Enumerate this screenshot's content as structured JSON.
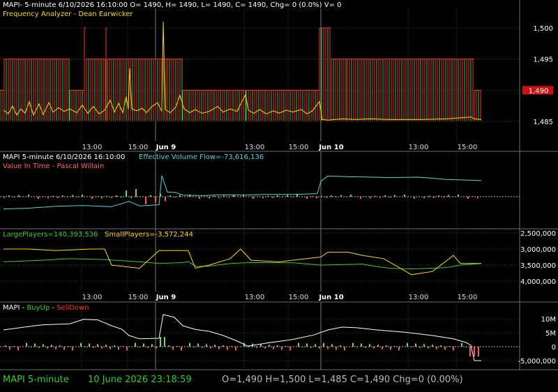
{
  "colors": {
    "background": "#000000",
    "grid": "#3a3a3a",
    "divider": "#6e6e6e",
    "label_white": "#ffffff",
    "yellow": "#ffd800",
    "red": "#ff3030",
    "green": "#33cc33",
    "cyan": "#4fd8d8",
    "up_bar": "#66dd66",
    "down_bar": "#ff5555",
    "status_green": "#29d12b",
    "status_gray": "#bbbbbb"
  },
  "panel1": {
    "header": "MAPI- 5-minute 6/10/2026 16:10:00 O= 1490, H= 1490, L= 1490, C= 1490, Chg= 0 (0.0%) V= 0",
    "study": "Frequency Analyzer - Dean Earwicker",
    "price_label": "1,490"
  },
  "panel2": {
    "header": "MAPI 5-minute  6/10/2026 16:10:00",
    "evf_label": "Effective Volume Flow=-73,616,136",
    "study": "Value In Time - Pascal Willain"
  },
  "panel3": {
    "large_label": "LargePlayers=140,393,536",
    "small_label": "SmallPlayers=-3,572,244"
  },
  "panel4": {
    "name": "MAPI",
    "sep1": " - ",
    "buyup": "BuyUp",
    "sep2": " - ",
    "selldown": "SellDown"
  },
  "status": {
    "symbol": "MAPI  5-minute",
    "datetime": "10 June 2026 23:18:59",
    "ohlc": "O=1,490  H=1,500  L=1,485  C=1,490  Chg=0 (0.00%)"
  },
  "chart_data": [
    {
      "type": "line",
      "title": "Frequency Analyzer - Dean Earwicker",
      "price_ticks": [
        "1,500",
        "1,495",
        "1,490",
        "1,485"
      ],
      "ylim": [
        1484,
        1502
      ],
      "x_tick_labels": [
        "13:00",
        "15:00",
        "Jun 9",
        "13:00",
        "15:00",
        "Jun 10",
        "13:00",
        "15:00"
      ],
      "price_steps": [
        {
          "x0": 0,
          "x1": 6,
          "value": 1490
        },
        {
          "x0": 6,
          "x1": 100,
          "value": 1495
        },
        {
          "x0": 100,
          "x1": 121,
          "value": 1490
        },
        {
          "x0": 121,
          "x1": 124,
          "value": 1500
        },
        {
          "x0": 124,
          "x1": 152,
          "value": 1495
        },
        {
          "x0": 152,
          "x1": 154,
          "value": 1500
        },
        {
          "x0": 154,
          "x1": 240,
          "value": 1495
        },
        {
          "x0": 240,
          "x1": 262,
          "value": 1495
        },
        {
          "x0": 262,
          "x1": 353,
          "value": 1490
        },
        {
          "x0": 353,
          "x1": 458,
          "value": 1490
        },
        {
          "x0": 458,
          "x1": 475,
          "value": 1500
        },
        {
          "x0": 475,
          "x1": 498,
          "value": 1495
        },
        {
          "x0": 498,
          "x1": 680,
          "value": 1495
        },
        {
          "x0": 680,
          "x1": 690,
          "value": 1490
        }
      ],
      "oscillator": [
        [
          5,
          1486.8
        ],
        [
          12,
          1486.2
        ],
        [
          18,
          1487.5
        ],
        [
          24,
          1486.0
        ],
        [
          30,
          1487.0
        ],
        [
          36,
          1486.3
        ],
        [
          42,
          1488.2
        ],
        [
          48,
          1486.0
        ],
        [
          56,
          1487.8
        ],
        [
          62,
          1486.1
        ],
        [
          70,
          1488.0
        ],
        [
          76,
          1486.5
        ],
        [
          84,
          1487.2
        ],
        [
          92,
          1486.6
        ],
        [
          100,
          1487.0
        ],
        [
          110,
          1486.4
        ],
        [
          118,
          1487.6
        ],
        [
          126,
          1486.3
        ],
        [
          134,
          1487.4
        ],
        [
          142,
          1486.2
        ],
        [
          150,
          1486.8
        ],
        [
          158,
          1488.4
        ],
        [
          164,
          1486.5
        ],
        [
          170,
          1487.9
        ],
        [
          176,
          1486.4
        ],
        [
          181,
          1489.0
        ],
        [
          184,
          1486.9
        ],
        [
          186,
          1493.5
        ],
        [
          189,
          1487.0
        ],
        [
          196,
          1486.7
        ],
        [
          204,
          1487.1
        ],
        [
          210,
          1486.4
        ],
        [
          218,
          1487.4
        ],
        [
          226,
          1488.0
        ],
        [
          232,
          1486.6
        ],
        [
          234,
          1501.0
        ],
        [
          237,
          1486.9
        ],
        [
          244,
          1486.4
        ],
        [
          252,
          1487.3
        ],
        [
          258,
          1489.2
        ],
        [
          264,
          1487.0
        ],
        [
          272,
          1486.4
        ],
        [
          280,
          1486.9
        ],
        [
          290,
          1486.3
        ],
        [
          300,
          1486.6
        ],
        [
          312,
          1487.4
        ],
        [
          320,
          1486.5
        ],
        [
          330,
          1487.0
        ],
        [
          340,
          1486.6
        ],
        [
          346,
          1488.0
        ],
        [
          352,
          1489.3
        ],
        [
          356,
          1486.8
        ],
        [
          364,
          1486.3
        ],
        [
          372,
          1486.9
        ],
        [
          382,
          1486.2
        ],
        [
          392,
          1486.7
        ],
        [
          400,
          1486.3
        ],
        [
          410,
          1486.8
        ],
        [
          420,
          1486.5
        ],
        [
          432,
          1486.9
        ],
        [
          440,
          1486.2
        ],
        [
          448,
          1486.7
        ],
        [
          458,
          1488.2
        ],
        [
          462,
          1485.3
        ],
        [
          470,
          1485.2
        ],
        [
          490,
          1485.4
        ],
        [
          510,
          1485.3
        ],
        [
          530,
          1485.4
        ],
        [
          560,
          1485.3
        ],
        [
          600,
          1485.3
        ],
        [
          640,
          1485.4
        ],
        [
          675,
          1485.7
        ],
        [
          680,
          1485.4
        ],
        [
          690,
          1485.3
        ]
      ]
    },
    {
      "type": "line",
      "title": "Effective Volume Flow",
      "series": [
        {
          "name": "Effective Volume Flow",
          "values": [
            [
              5,
              -3.2
            ],
            [
              40,
              -3.0
            ],
            [
              80,
              -2.5
            ],
            [
              120,
              -2.3
            ],
            [
              160,
              -2.6
            ],
            [
              185,
              -1.2
            ],
            [
              200,
              -2.4
            ],
            [
              228,
              -2.1
            ],
            [
              232,
              5.5
            ],
            [
              240,
              1.2
            ],
            [
              252,
              1.1
            ],
            [
              262,
              0.4
            ],
            [
              290,
              0.3
            ],
            [
              320,
              0.5
            ],
            [
              350,
              0.4
            ],
            [
              380,
              0.6
            ],
            [
              420,
              0.6
            ],
            [
              455,
              0.8
            ],
            [
              460,
              4.0
            ],
            [
              470,
              5.4
            ],
            [
              500,
              5.2
            ],
            [
              560,
              5.0
            ],
            [
              600,
              5.1
            ],
            [
              640,
              4.5
            ],
            [
              690,
              4.2
            ]
          ]
        }
      ],
      "ylim": [
        -8,
        9
      ]
    },
    {
      "type": "line",
      "title": "LargePlayers / SmallPlayers",
      "y_ticks": [
        "2,500,000",
        "3,000,000",
        "3,500,000",
        "4,000,000"
      ],
      "ylim": [
        2300000,
        4100000
      ],
      "x_tick_labels": [
        "13:00",
        "15:00",
        "Jun 9",
        "13:00",
        "15:00",
        "Jun 10",
        "13:00",
        "15:00"
      ],
      "series": [
        {
          "name": "LargePlayers",
          "values": [
            [
              5,
              3400000
            ],
            [
              60,
              3350000
            ],
            [
              100,
              3300000
            ],
            [
              150,
              3330000
            ],
            [
              200,
              3400000
            ],
            [
              230,
              3450000
            ],
            [
              262,
              3420000
            ],
            [
              270,
              3400000
            ],
            [
              282,
              3550000
            ],
            [
              300,
              3530000
            ],
            [
              330,
              3450000
            ],
            [
              360,
              3420000
            ],
            [
              420,
              3430000
            ],
            [
              460,
              3500000
            ],
            [
              500,
              3480000
            ],
            [
              520,
              3470000
            ],
            [
              540,
              3550000
            ],
            [
              560,
              3600000
            ],
            [
              590,
              3620000
            ],
            [
              640,
              3580000
            ],
            [
              660,
              3500000
            ],
            [
              690,
              3450000
            ]
          ]
        },
        {
          "name": "SmallPlayers",
          "values": [
            [
              5,
              3000000
            ],
            [
              40,
              3000000
            ],
            [
              80,
              3050000
            ],
            [
              130,
              3000000
            ],
            [
              150,
              3000000
            ],
            [
              160,
              3500000
            ],
            [
              200,
              3600000
            ],
            [
              228,
              3050000
            ],
            [
              270,
              3050000
            ],
            [
              280,
              3600000
            ],
            [
              300,
              3500000
            ],
            [
              330,
              3300000
            ],
            [
              345,
              3000000
            ],
            [
              360,
              3350000
            ],
            [
              400,
              3400000
            ],
            [
              440,
              3300000
            ],
            [
              460,
              3250000
            ],
            [
              470,
              3100000
            ],
            [
              500,
              3100000
            ],
            [
              520,
              3200000
            ],
            [
              550,
              3300000
            ],
            [
              590,
              3800000
            ],
            [
              620,
              3700000
            ],
            [
              650,
              3200000
            ],
            [
              660,
              3450000
            ],
            [
              690,
              3450000
            ]
          ]
        }
      ]
    },
    {
      "type": "bar",
      "title": "BuyUp - SellDown",
      "y_ticks": [
        "10M",
        "5M",
        "0",
        "-5,000,000"
      ],
      "ylim": [
        -6000000,
        12000000
      ],
      "series": [
        {
          "name": "cumulative",
          "values": [
            [
              5,
              6000000
            ],
            [
              20,
              6500000
            ],
            [
              40,
              7200000
            ],
            [
              60,
              7800000
            ],
            [
              80,
              8000000
            ],
            [
              100,
              8200000
            ],
            [
              120,
              9800000
            ],
            [
              140,
              9600000
            ],
            [
              160,
              7500000
            ],
            [
              175,
              6200000
            ],
            [
              185,
              4000000
            ],
            [
              200,
              2800000
            ],
            [
              228,
              3000000
            ],
            [
              234,
              11500000
            ],
            [
              250,
              10500000
            ],
            [
              262,
              7500000
            ],
            [
              280,
              6200000
            ],
            [
              300,
              5500000
            ],
            [
              320,
              4000000
            ],
            [
              340,
              2000000
            ],
            [
              355,
              200000
            ],
            [
              380,
              1200000
            ],
            [
              420,
              2600000
            ],
            [
              450,
              4200000
            ],
            [
              470,
              6000000
            ],
            [
              490,
              7000000
            ],
            [
              510,
              6800000
            ],
            [
              540,
              6000000
            ],
            [
              580,
              5200000
            ],
            [
              620,
              4000000
            ],
            [
              650,
              2800000
            ],
            [
              668,
              1500000
            ],
            [
              675,
              500000
            ],
            [
              680,
              -5000000
            ],
            [
              690,
              -5000000
            ]
          ]
        }
      ]
    }
  ]
}
